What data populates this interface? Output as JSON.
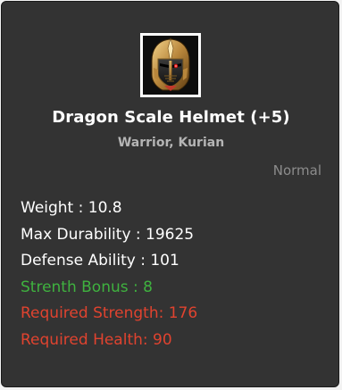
{
  "item": {
    "name": "Dragon Scale Helmet (+5)",
    "classes": "Warrior, Kurian",
    "grade": "Normal",
    "icon": "dragon-scale-helmet-icon"
  },
  "stats": {
    "weight": "Weight : 10.8",
    "max_durability": "Max Durability : 19625",
    "defense_ability": "Defense Ability : 101",
    "strength_bonus": "Strenth Bonus : 8",
    "required_strength": "Required Strength: 176",
    "required_health": "Required Health: 90"
  },
  "colors": {
    "panel_background": "#333333",
    "name": "#ffffff",
    "classes": "#b5b5b5",
    "grade": "#8c8c8c",
    "bonus": "#3fb23f",
    "requirement": "#e0432f"
  }
}
